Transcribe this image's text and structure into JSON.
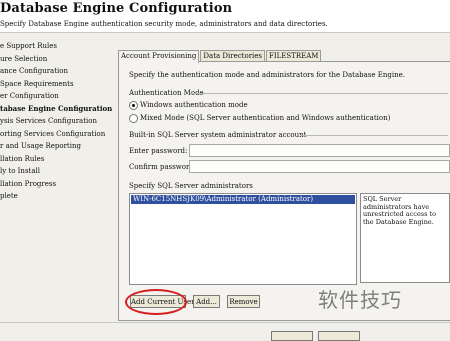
{
  "header": {
    "title": "Database Engine Configuration",
    "subtitle": "Specify Database Engine authentication security mode, administrators and data directories."
  },
  "nav": {
    "items": [
      {
        "label": "e Support Rules"
      },
      {
        "label": "ure Selection"
      },
      {
        "label": "ance Configuration"
      },
      {
        "label": "Space Requirements"
      },
      {
        "label": "er Configuration"
      },
      {
        "label": "tabase Engine Configuration",
        "active": true
      },
      {
        "label": "ysis Services Configuration"
      },
      {
        "label": "orting Services Configuration"
      },
      {
        "label": "r and Usage Reporting"
      },
      {
        "label": "llation Rules"
      },
      {
        "label": "ly to Install"
      },
      {
        "label": "llation Progress"
      },
      {
        "label": "plete"
      }
    ]
  },
  "tabs": [
    {
      "label": "Account Provisioning"
    },
    {
      "label": "Data Directories"
    },
    {
      "label": "FILESTREAM"
    }
  ],
  "main": {
    "intro": "Specify the authentication mode and administrators for the Database Engine.",
    "auth_mode_label": "Authentication Mode",
    "windows_auth_label": "Windows authentication mode",
    "mixed_mode_label": "Mixed Mode (SQL Server authentication and Windows authentication)",
    "builtin_account_label": "Built-in SQL Server system administrator account",
    "enter_password_label": "Enter password:",
    "confirm_password_label": "Confirm password:",
    "administrators_label": "Specify SQL Server administrators",
    "admin_entry": "WIN-6C15NHSJK09\\Administrator (Administrator)",
    "info_text": "SQL Server administrators have unrestricted access to the Database Engine.",
    "add_current_user": "Add Current User",
    "add": "Add...",
    "remove": "Remove"
  },
  "watermark": "软件技巧"
}
